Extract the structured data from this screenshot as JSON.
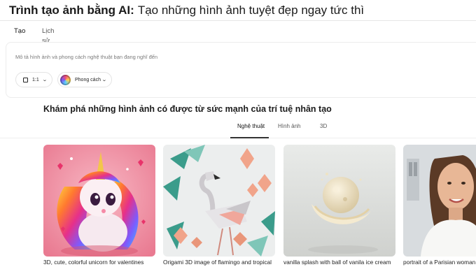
{
  "header": {
    "title_bold": "Trình tạo ảnh bằng AI:",
    "title_rest": "Tạo những hình ảnh tuyệt đẹp ngay tức thì"
  },
  "top_tabs": [
    {
      "label": "Tạo",
      "active": true
    },
    {
      "label": "Lịch sử",
      "active": false
    }
  ],
  "prompt": {
    "placeholder": "Mô tả hình ảnh và phong cách nghệ thuật bạn đang nghĩ đến",
    "value": ""
  },
  "options": {
    "ratio_label": "1:1",
    "style_label": "Phong cách"
  },
  "explore": {
    "title": "Khám phá những hình ảnh có được từ sức mạnh của trí tuệ nhân tạo",
    "tabs": [
      {
        "label": "Nghệ thuật",
        "active": true
      },
      {
        "label": "Hình ảnh",
        "active": false
      },
      {
        "label": "3D",
        "active": false
      }
    ]
  },
  "gallery": [
    {
      "caption": "3D, cute, colorful unicorn for valentines"
    },
    {
      "caption": "Origami 3D image of flamingo and tropical"
    },
    {
      "caption": "vanilla splash with ball of vanila ice cream"
    },
    {
      "caption": "portrait of a Parisian woman"
    }
  ],
  "colors": {
    "accent_underline": "#333333"
  }
}
